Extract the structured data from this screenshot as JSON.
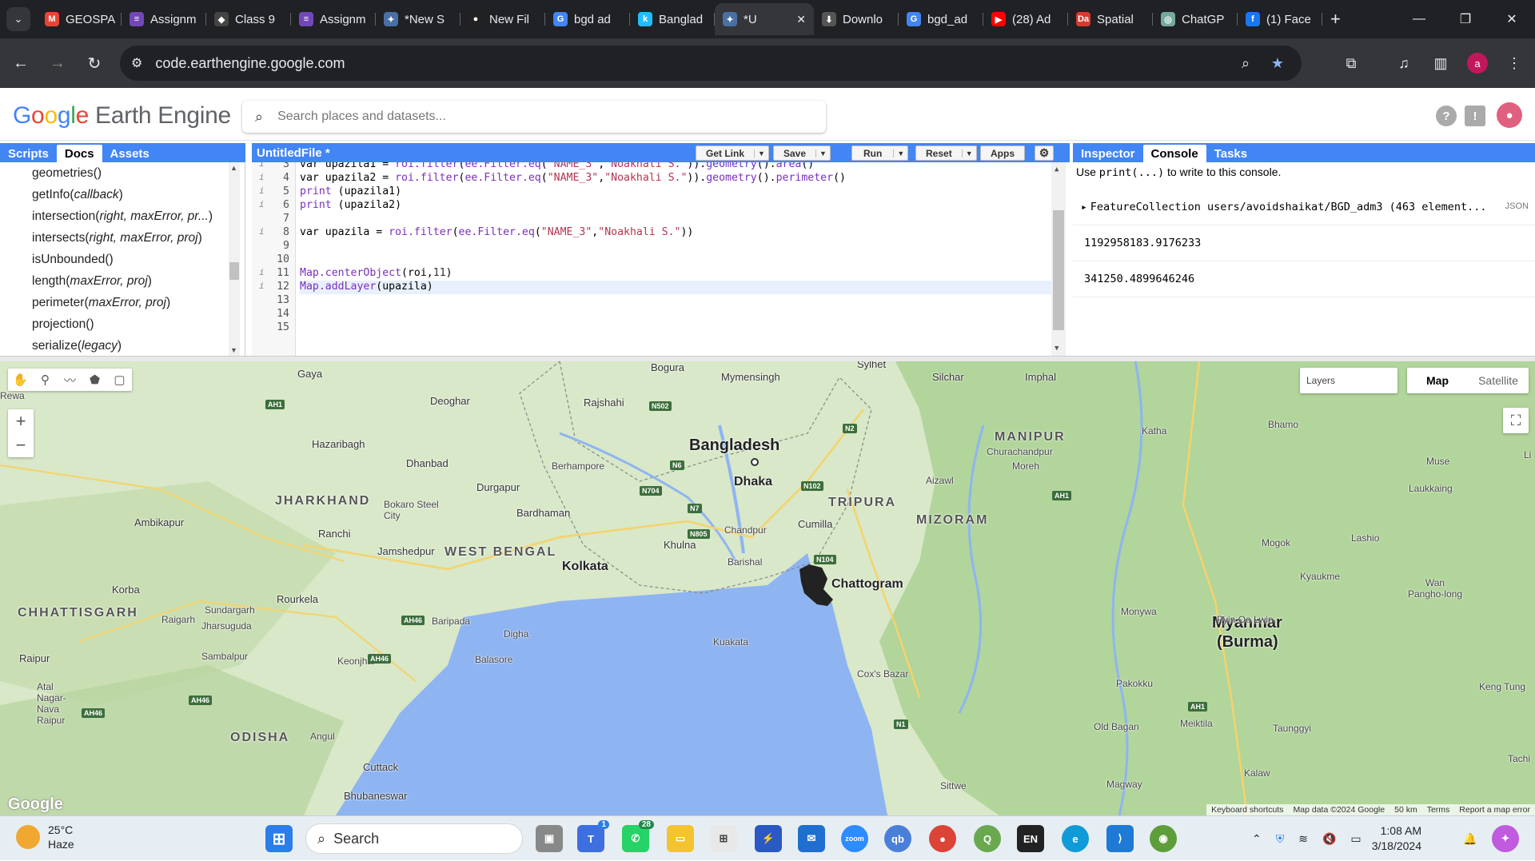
{
  "browser": {
    "tabs": [
      {
        "label": "GEOSPA",
        "fav": "M",
        "color": "#ea4335"
      },
      {
        "label": "Assignm",
        "fav": "≡",
        "color": "#7248b9"
      },
      {
        "label": "Class 9",
        "fav": "◆",
        "color": "#444"
      },
      {
        "label": "Assignm",
        "fav": "≡",
        "color": "#7248b9"
      },
      {
        "label": "*New S",
        "fav": "✦",
        "color": "#4a6fa5"
      },
      {
        "label": "New Fil",
        "fav": "●",
        "color": "#222"
      },
      {
        "label": "bgd ad",
        "fav": "G",
        "color": "#4285f4"
      },
      {
        "label": "Banglad",
        "fav": "k",
        "color": "#20beff"
      },
      {
        "label": "*U",
        "fav": "✦",
        "color": "#4a6fa5",
        "active": true
      },
      {
        "label": "Downlo",
        "fav": "⬇",
        "color": "#555"
      },
      {
        "label": "bgd_ad",
        "fav": "G",
        "color": "#4285f4"
      },
      {
        "label": "(28) Ad",
        "fav": "▶",
        "color": "#ff0000"
      },
      {
        "label": "Spatial",
        "fav": "Da",
        "color": "#d63b2f"
      },
      {
        "label": "ChatGP",
        "fav": "◎",
        "color": "#74aa9c"
      },
      {
        "label": "(1) Face",
        "fav": "f",
        "color": "#1877f2"
      }
    ],
    "url": "code.earthengine.google.com",
    "avatar_letter": "a"
  },
  "ee": {
    "logo_text": "Earth Engine",
    "search_placeholder": "Search places and datasets...",
    "left_tabs": [
      "Scripts",
      "Docs",
      "Assets"
    ],
    "docs": [
      {
        "name": "geometries",
        "args": ""
      },
      {
        "name": "getInfo",
        "args": "callback"
      },
      {
        "name": "intersection",
        "args": "right, maxError, pr..."
      },
      {
        "name": "intersects",
        "args": "right, maxError, proj"
      },
      {
        "name": "isUnbounded",
        "args": ""
      },
      {
        "name": "length",
        "args": "maxError, proj"
      },
      {
        "name": "perimeter",
        "args": "maxError, proj"
      },
      {
        "name": "projection",
        "args": ""
      },
      {
        "name": "serialize",
        "args": "legacy"
      }
    ],
    "editor": {
      "file_title": "UntitledFile *",
      "buttons": {
        "get_link": "Get Link",
        "save": "Save",
        "run": "Run",
        "reset": "Reset",
        "apps": "Apps"
      },
      "line_numbers": [
        "3",
        "4",
        "5",
        "6",
        "7",
        "8",
        "9",
        "10",
        "11",
        "12",
        "13",
        "14",
        "15"
      ]
    },
    "right_tabs": [
      "Inspector",
      "Console",
      "Tasks"
    ],
    "console": {
      "hint_pre": "Use ",
      "hint_code": "print(...)",
      "hint_post": " to write to this console.",
      "feature_collection": "FeatureCollection users/avoidshaikat/BGD_adm3 (463 element...",
      "json_label": "JSON",
      "area_value": "1192958183.9176233",
      "perimeter_value": "341250.4899646246"
    }
  },
  "map": {
    "layers_label": "Layers",
    "map_type_map": "Map",
    "map_type_satellite": "Satellite",
    "zoom_in": "+",
    "zoom_out": "−",
    "watermark": "Google",
    "attribution": [
      "Keyboard shortcuts",
      "Map data ©2024 Google",
      "50 km",
      "Terms",
      "Report a map error"
    ],
    "labels": {
      "bangladesh": "Bangladesh",
      "myanmar": "Myanmar",
      "burma": "(Burma)",
      "dhaka": "Dhaka",
      "kolkata": "Kolkata",
      "chattogram": "Chattogram",
      "west_bengal": "WEST BENGAL",
      "jharkhand": "JHARKHAND",
      "tripura": "TRIPURA",
      "mizoram": "MIZORAM",
      "manipur": "MANIPUR",
      "odisha": "ODISHA",
      "chhattisgarh": "CHHATTISGARH",
      "gaya": "Gaya",
      "rajshahi": "Rajshahi",
      "mymensingh": "Mymensingh",
      "bogura": "Bogura",
      "sylhet": "Sylhet",
      "silchar": "Silchar",
      "imphal": "Imphal",
      "hazaribagh": "Hazaribagh",
      "dhanbad": "Dhanbad",
      "deoghar": "Deoghar",
      "durgapur": "Durgapur",
      "bardhaman": "Bardhaman",
      "berhampore": "Berhampore",
      "bokaro": "Bokaro Steel City",
      "ranchi": "Ranchi",
      "jamshedpur": "Jamshedpur",
      "ambikapur": "Ambikapur",
      "korba": "Korba",
      "raigarh": "Raigarh",
      "sundargarh": "Sundargarh",
      "jharsuguda": "Jharsuguda",
      "rourkela": "Rourkela",
      "baripada": "Baripada",
      "balasore": "Balasore",
      "digha": "Digha",
      "sambalpur": "Sambalpur",
      "keonjhar": "Keonjhar",
      "raipur": "Raipur",
      "atal": "Atal Nagar-Nava Raipur",
      "angul": "Angul",
      "cuttack": "Cuttack",
      "bhubaneswar": "Bhubaneswar",
      "khulna": "Khulna",
      "barishal": "Barishal",
      "chandpur": "Chandpur",
      "cumilla": "Cumilla",
      "kuakata": "Kuakata",
      "aizawl": "Aizawl",
      "churachandpur": "Churachandpur",
      "moreh": "Moreh",
      "coxs_bazar": "Cox's Bazar",
      "sittwe": "Sittwe",
      "katha": "Katha",
      "bhamo": "Bhamo",
      "muse": "Muse",
      "laukkaing": "Laukkaing",
      "lashio": "Lashio",
      "mogok": "Mogok",
      "kyaukme": "Kyaukme",
      "wan_pangho": "Wan Pangho-long",
      "monywa": "Monywa",
      "pyin_oo_lwin": "Pyin Oo Lwin",
      "pakokku": "Pakokku",
      "keng_tung": "Keng Tung",
      "old_bagan": "Old Bagan",
      "meiktila": "Meiktila",
      "taunggyi": "Taunggyi",
      "kalaw": "Kalaw",
      "magway": "Magway",
      "tachi": "Tachi",
      "li": "Li",
      "rewa": "Rewa"
    },
    "shields": [
      "AH1",
      "N502",
      "N6",
      "N704",
      "N7",
      "N805",
      "N102",
      "N2",
      "N104",
      "AH46",
      "AH46",
      "AH46",
      "AH46",
      "AH1",
      "AH1",
      "N1"
    ]
  },
  "taskbar": {
    "temp": "25°C",
    "weather": "Haze",
    "search_label": "Search",
    "lang": "EN",
    "time": "1:08 AM",
    "date": "3/18/2024",
    "badge_todo": "1",
    "badge_whatsapp": "28"
  },
  "colors": {
    "accent": "#4285f4",
    "tabbar": "#202124",
    "water": "#8fb4f2",
    "land": "#d8e8c8"
  }
}
